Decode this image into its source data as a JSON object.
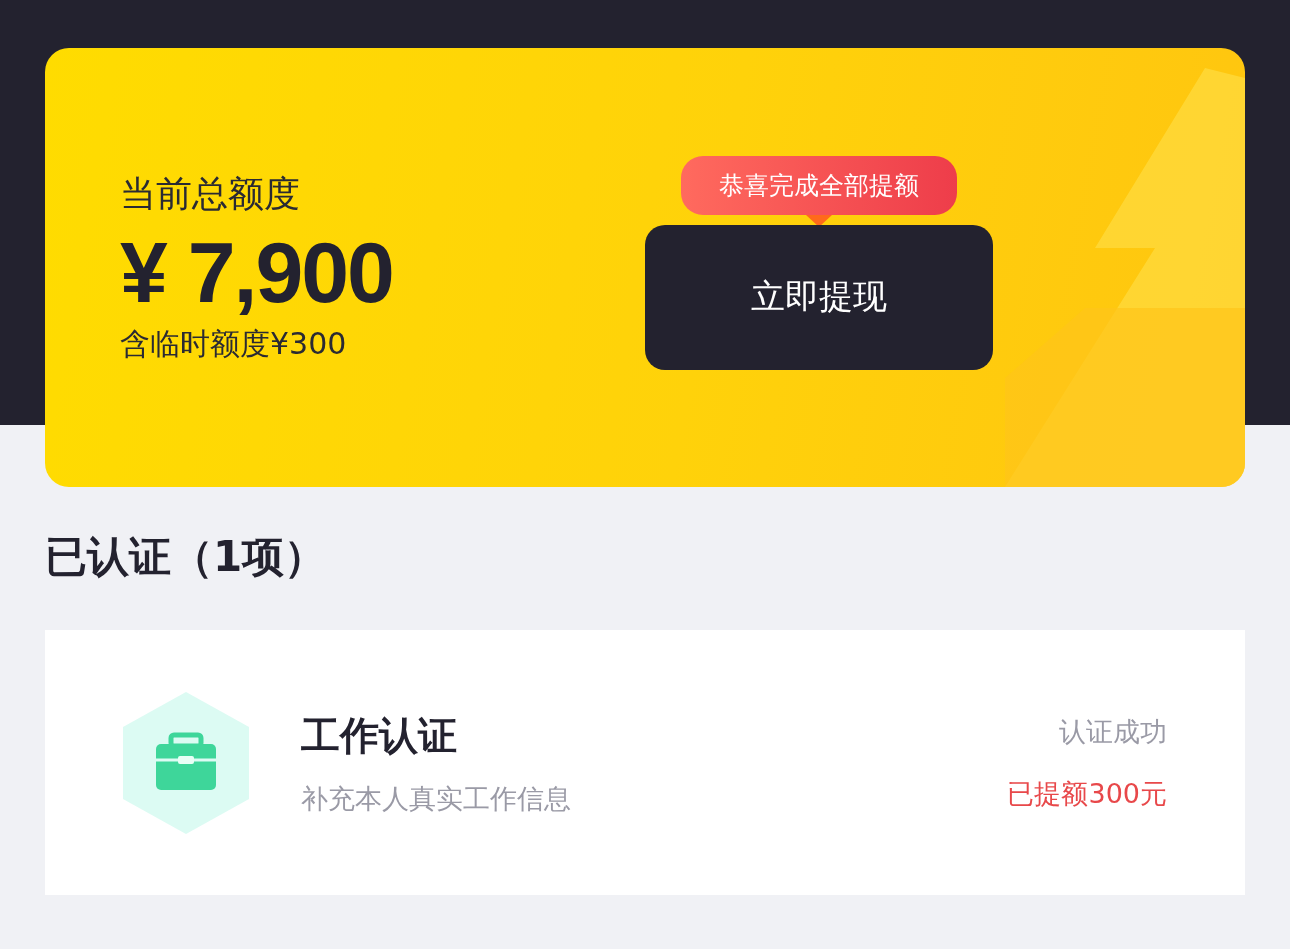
{
  "credit_card": {
    "label": "当前总额度",
    "amount": "¥ 7,900",
    "note": "含临时额度¥300",
    "badge": "恭喜完成全部提额",
    "withdraw_button": "立即提现"
  },
  "section_title": "已认证（1项）",
  "items": [
    {
      "title": "工作认证",
      "subtitle": "补充本人真实工作信息",
      "status": "认证成功",
      "bonus": "已提额300元"
    }
  ]
}
